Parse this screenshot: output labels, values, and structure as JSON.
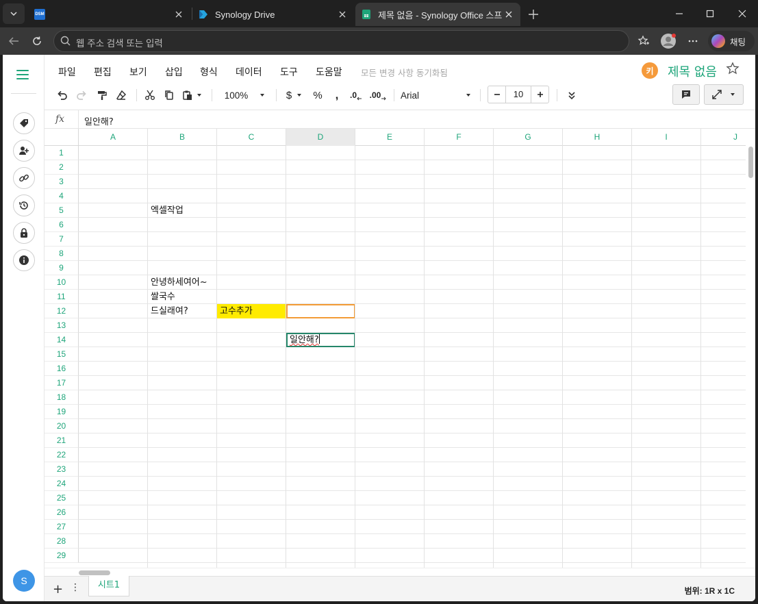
{
  "browser": {
    "tabs": [
      {
        "title": "",
        "favicon": "dsm-icon"
      },
      {
        "title": "Synology Drive",
        "favicon": "synology-drive-icon"
      },
      {
        "title": "제목 없음 - Synology Office 스프레",
        "favicon": "synology-sheet-icon"
      }
    ],
    "favicon_dsm_text": "DSM",
    "address_placeholder": "웹 주소 검색 또는 입력",
    "copilot_label": "채팅"
  },
  "menu": {
    "items": [
      "파일",
      "편집",
      "보기",
      "삽입",
      "형식",
      "데이터",
      "도구",
      "도움말"
    ],
    "sync_status": "모든 변경 사항 동기화됨"
  },
  "document": {
    "badge_letter": "키",
    "title": "제목 없음"
  },
  "toolbar": {
    "zoom": "100%",
    "currency": "$",
    "percent": "%",
    "comma": ",",
    "decrease_decimal": ".0",
    "increase_decimal": ".00",
    "font_name": "Arial",
    "font_size": "10"
  },
  "formula_bar": {
    "fx_label": "fx",
    "value": "일안해?"
  },
  "grid": {
    "columns": [
      "A",
      "B",
      "C",
      "D",
      "E",
      "F",
      "G",
      "H",
      "I",
      "J"
    ],
    "selected_column": "D",
    "rows": [
      "1",
      "2",
      "3",
      "4",
      "5",
      "6",
      "7",
      "8",
      "9",
      "10",
      "11",
      "12",
      "13",
      "14",
      "15",
      "16",
      "17",
      "18",
      "19",
      "20",
      "21",
      "22",
      "23",
      "24",
      "25",
      "26",
      "27",
      "28",
      "29"
    ],
    "cells": {
      "B5": "엑셀작업",
      "B10": "안녕하세여어~",
      "B11": "쌀국수",
      "B12": "드실래여?",
      "C12": "고수추가",
      "D14": "일안해?"
    },
    "highlight_color": "#ffeb00",
    "selection_color": "#f39b35",
    "edit_color": "#25866a"
  },
  "sheets": {
    "tabs": [
      "시트1"
    ],
    "range_info": "범위: 1R x 1C"
  },
  "sidebar": {
    "avatar_letter": "S",
    "icons": [
      "tag-icon",
      "add-user-icon",
      "link-icon",
      "history-icon",
      "lock-icon",
      "info-icon"
    ]
  },
  "colors": {
    "accent": "#1ea57a"
  }
}
